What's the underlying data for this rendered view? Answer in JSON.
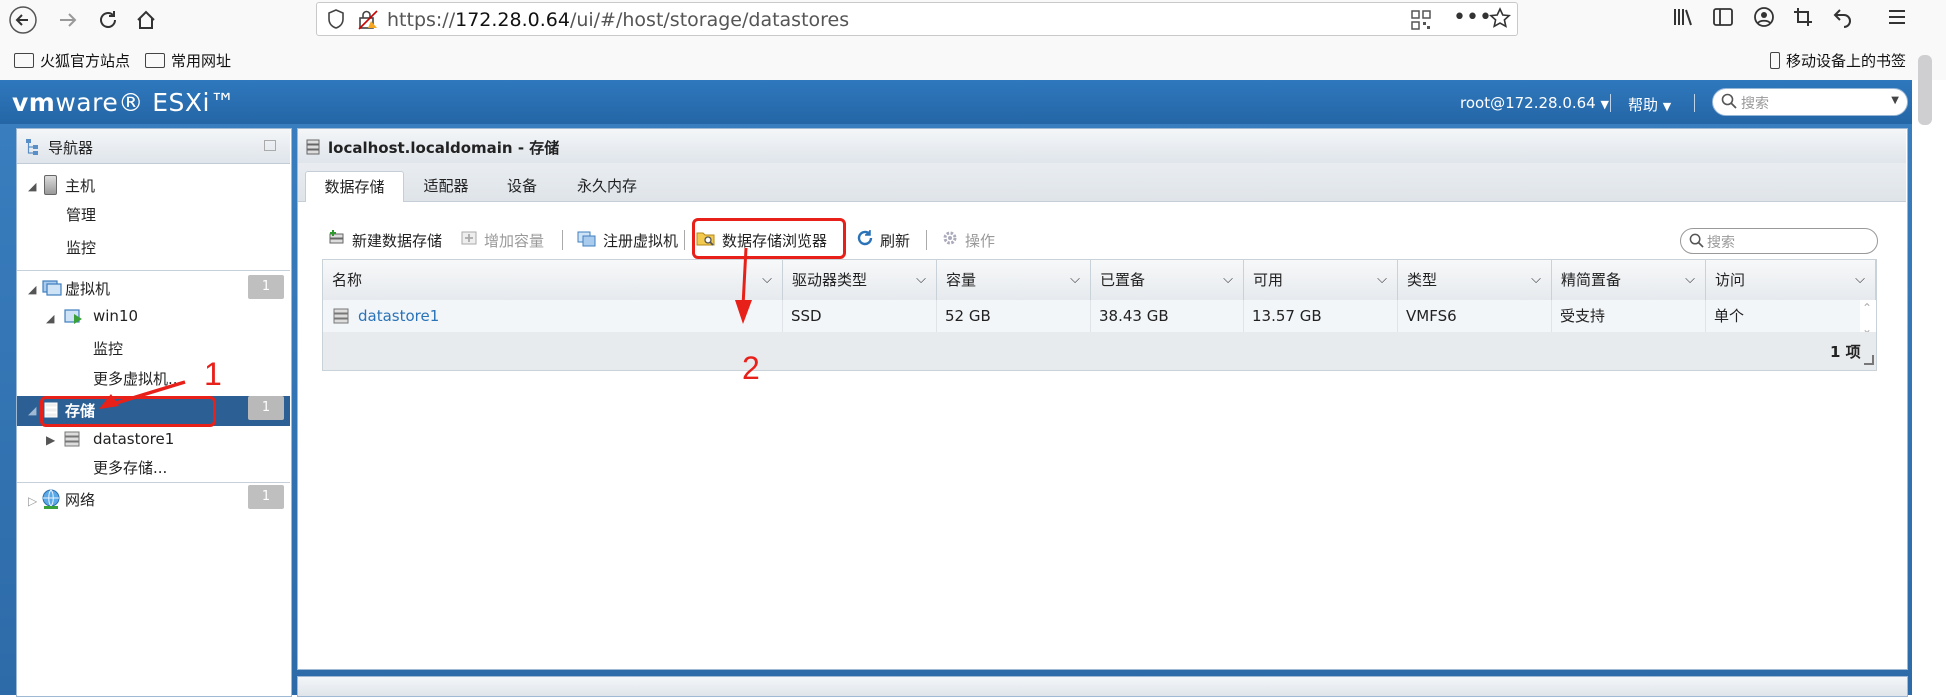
{
  "browser": {
    "url_prefix": "https://",
    "url_host": "172.28.0.64",
    "url_path": "/ui/#/host/storage/datastores",
    "bookmarks": [
      "火狐官方站点",
      "常用网址"
    ],
    "mobile_bookmarks": "移动设备上的书签"
  },
  "esxi": {
    "logo_vm": "vm",
    "logo_ware": "ware",
    "logo_product": "ESXi",
    "user": "root@172.28.0.64",
    "help": "帮助",
    "search_placeholder": "搜索"
  },
  "navigator": {
    "title": "导航器",
    "host_label": "主机",
    "host_children": [
      "管理",
      "监控"
    ],
    "vm_label": "虚拟机",
    "vm_count": "1",
    "vm_name": "win10",
    "vm_children": [
      "监控",
      "更多虚拟机..."
    ],
    "storage_label": "存储",
    "storage_count": "1",
    "datastore_name": "datastore1",
    "more_storage": "更多存储...",
    "network_label": "网络",
    "network_count": "1"
  },
  "main": {
    "title": "localhost.localdomain - 存储",
    "tabs": [
      "数据存储",
      "适配器",
      "设备",
      "永久内存"
    ],
    "active_tab": "数据存储",
    "toolbar": {
      "new_datastore": "新建数据存储",
      "increase_capacity": "增加容量",
      "register_vm": "注册虚拟机",
      "datastore_browser": "数据存储浏览器",
      "refresh": "刷新",
      "actions": "操作"
    },
    "grid_search_placeholder": "搜索",
    "columns": [
      "名称",
      "驱动器类型",
      "容量",
      "已置备",
      "可用",
      "类型",
      "精简置备",
      "访问"
    ],
    "rows": [
      {
        "name": "datastore1",
        "drive_type": "SSD",
        "capacity": "52 GB",
        "provisioned": "38.43 GB",
        "free": "13.57 GB",
        "type": "VMFS6",
        "thin": "受支持",
        "access": "单个"
      }
    ],
    "footer_count": "1 项"
  },
  "annotations": {
    "label_1": "1",
    "label_2": "2",
    "accent_color": "#e8201a"
  },
  "colors": {
    "esxi_header": "#2f78bd",
    "nav_selected": "#2c5f93",
    "link": "#2a73b8"
  }
}
